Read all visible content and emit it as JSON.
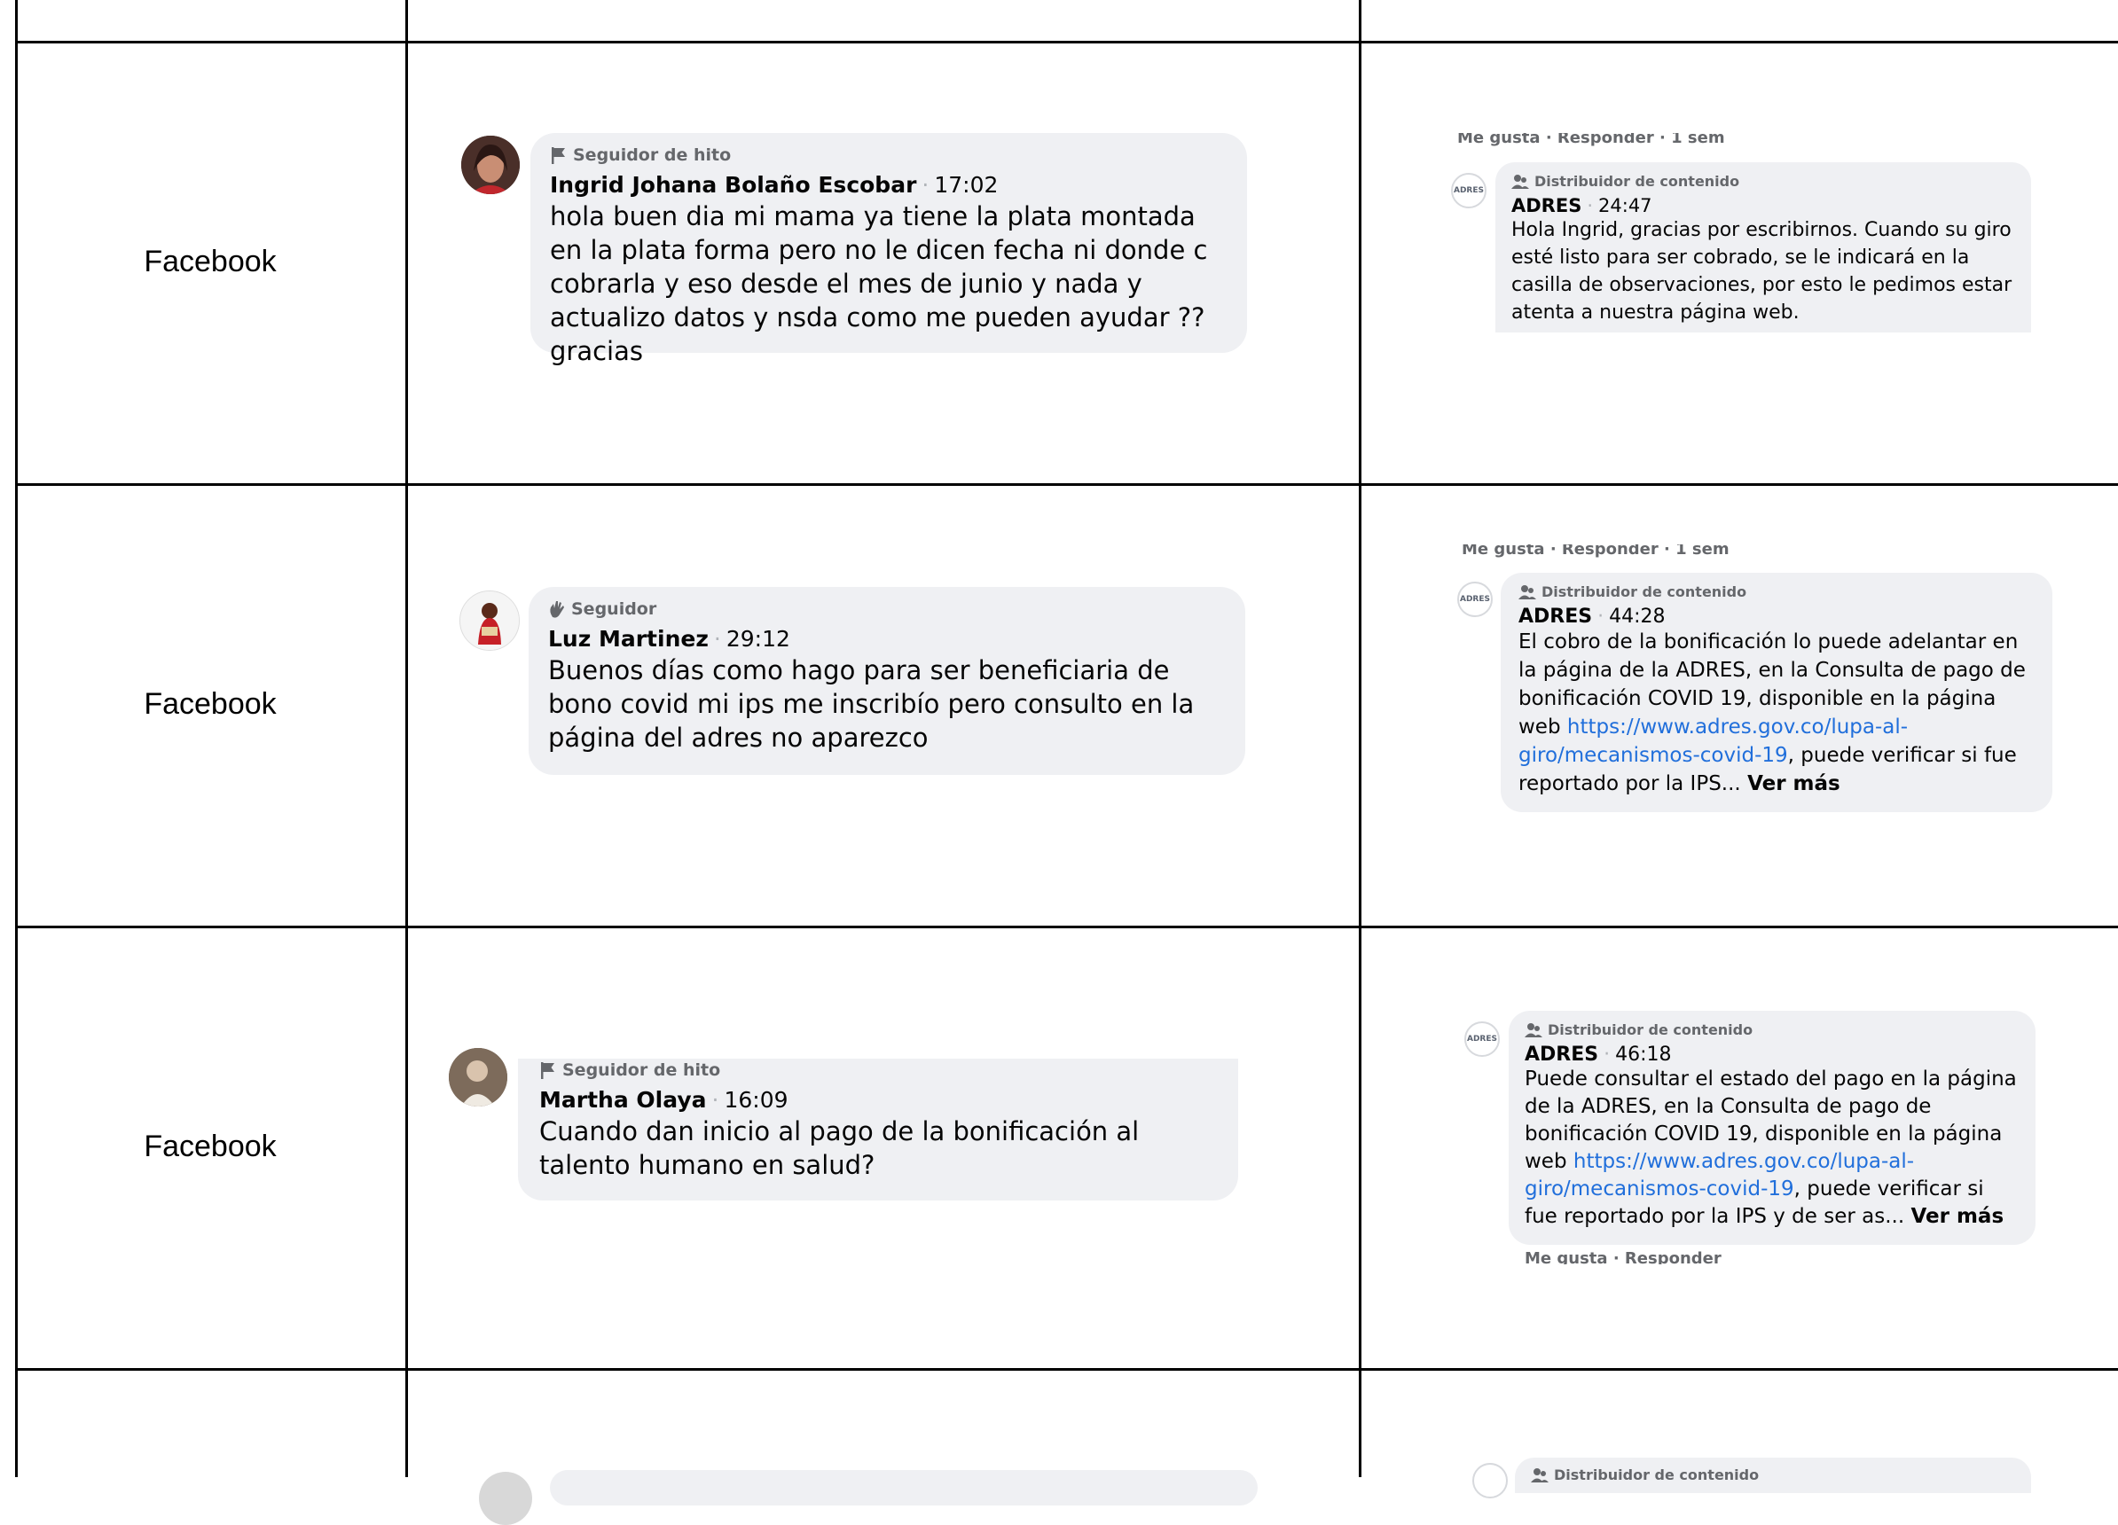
{
  "rows": [
    {
      "platform": "Facebook",
      "comment": {
        "badge": "Seguidor de hito",
        "author": "Ingrid Johana Bolaño Escobar",
        "time": "17:02",
        "text": "hola buen dia mi mama ya tiene la plata montada en la plata forma pero no le dicen fecha ni donde c cobrarla y eso desde el mes de junio y nada y actualizo datos y nsda como me pueden ayudar ?? gracias"
      },
      "reply": {
        "header_faded": "Me gusta · Responder · 1 sem",
        "avatar_text": "ADRES",
        "badge": "Distribuidor de contenido",
        "author": "ADRES",
        "time": "24:47",
        "text": "Hola Ingrid, gracias por escribirnos. Cuando su giro esté listo para ser cobrado, se le indicará en la casilla de observaciones, por esto le pedimos estar atenta a nuestra página web."
      }
    },
    {
      "platform": "Facebook",
      "comment": {
        "badge": "Seguidor",
        "author": "Luz Martinez",
        "time": "29:12",
        "text": "Buenos días como hago para ser beneficiaria de bono covid mi ips me inscribío pero consulto en la página del adres no aparezco"
      },
      "reply": {
        "header_faded": "Me gusta · Responder · 1 sem",
        "avatar_text": "ADRES",
        "badge": "Distribuidor de contenido",
        "author": "ADRES",
        "time": "44:28",
        "text_before": "El cobro de la bonificación lo puede adelantar en la página de la ADRES, en la Consulta de pago de bonificación COVID 19, disponible en la página web ",
        "link": "https://www.adres.gov.co/lupa-al-giro/mecanismos-covid-19",
        "text_after": ", puede verificar si fue reportado por la IPS... ",
        "more": "Ver más"
      }
    },
    {
      "platform": "Facebook",
      "comment": {
        "badge": "Seguidor de hito",
        "author": "Martha Olaya",
        "time": "16:09",
        "text": "Cuando dan inicio al pago de la bonificación al talento humano en salud?"
      },
      "reply": {
        "avatar_text": "ADRES",
        "badge": "Distribuidor de contenido",
        "author": "ADRES",
        "time": "46:18",
        "text_before": "Puede consultar el estado del pago en la página de la ADRES, en la Consulta de pago de bonificación COVID 19, disponible en la página web ",
        "link": "https://www.adres.gov.co/lupa-al-giro/mecanismos-covid-19",
        "text_after": ", puede verificar si fue reportado por la IPS y de ser as... ",
        "more": "Ver más",
        "footer_faded": "Me gusta · Responder"
      }
    },
    {
      "reply": {
        "badge": "Distribuidor de contenido"
      }
    }
  ]
}
